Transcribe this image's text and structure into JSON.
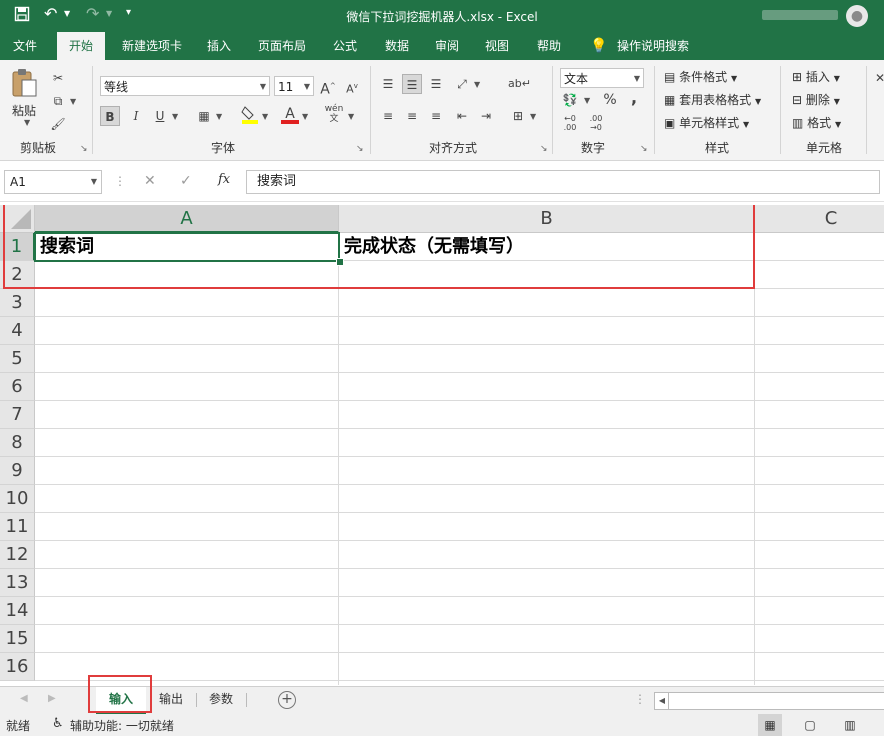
{
  "titlebar": {
    "title": "微信下拉词挖掘机器人.xlsx  -  Excel",
    "save_icon": "save-icon",
    "undo_icon": "undo-icon",
    "redo_icon": "redo-icon",
    "customize_icon": "customize-qat-icon",
    "bg_color": "#217346"
  },
  "tabs": [
    "文件",
    "开始",
    "新建选项卡",
    "插入",
    "页面布局",
    "公式",
    "数据",
    "审阅",
    "视图",
    "帮助",
    "操作说明搜索"
  ],
  "active_tab": "开始",
  "ribbon": {
    "clipboard": {
      "paste": "粘贴",
      "label": "剪贴板"
    },
    "font": {
      "name": "等线",
      "size": "11",
      "label": "字体",
      "bold": "B",
      "italic": "I",
      "underline": "U",
      "grow": "A",
      "shrink": "A",
      "font_color_letter": "A",
      "phonetic": "wén"
    },
    "alignment": {
      "label": "对齐方式"
    },
    "number": {
      "format": "文本",
      "percent": "%",
      "comma": ",",
      "label": "数字"
    },
    "styles": {
      "conditional": "条件格式",
      "table": "套用表格格式",
      "cell_styles": "单元格样式",
      "label": "样式"
    },
    "cells": {
      "insert": "插入",
      "delete": "删除",
      "format": "格式",
      "label": "单元格"
    }
  },
  "formula_bar": {
    "name_box": "A1",
    "cancel": "✕",
    "enter": "✓",
    "fx": "fx",
    "content": "搜索词"
  },
  "sheet": {
    "columns": [
      "A",
      "B",
      "C"
    ],
    "rows": [
      "1",
      "2",
      "3",
      "4",
      "5",
      "6",
      "7",
      "8",
      "9",
      "10",
      "11",
      "12",
      "13",
      "14",
      "15",
      "16"
    ],
    "cells": {
      "A1": "搜索词",
      "B1": "完成状态（无需填写）"
    },
    "selected_cell": "A1"
  },
  "sheet_tabs": [
    "输入",
    "输出",
    "参数"
  ],
  "active_sheet": "输入",
  "add_sheet": "+",
  "status": {
    "ready": "就绪",
    "accessibility": "辅助功能: 一切就绪"
  },
  "colors": {
    "accent": "#217346",
    "highlight_box": "#e03c3c"
  }
}
